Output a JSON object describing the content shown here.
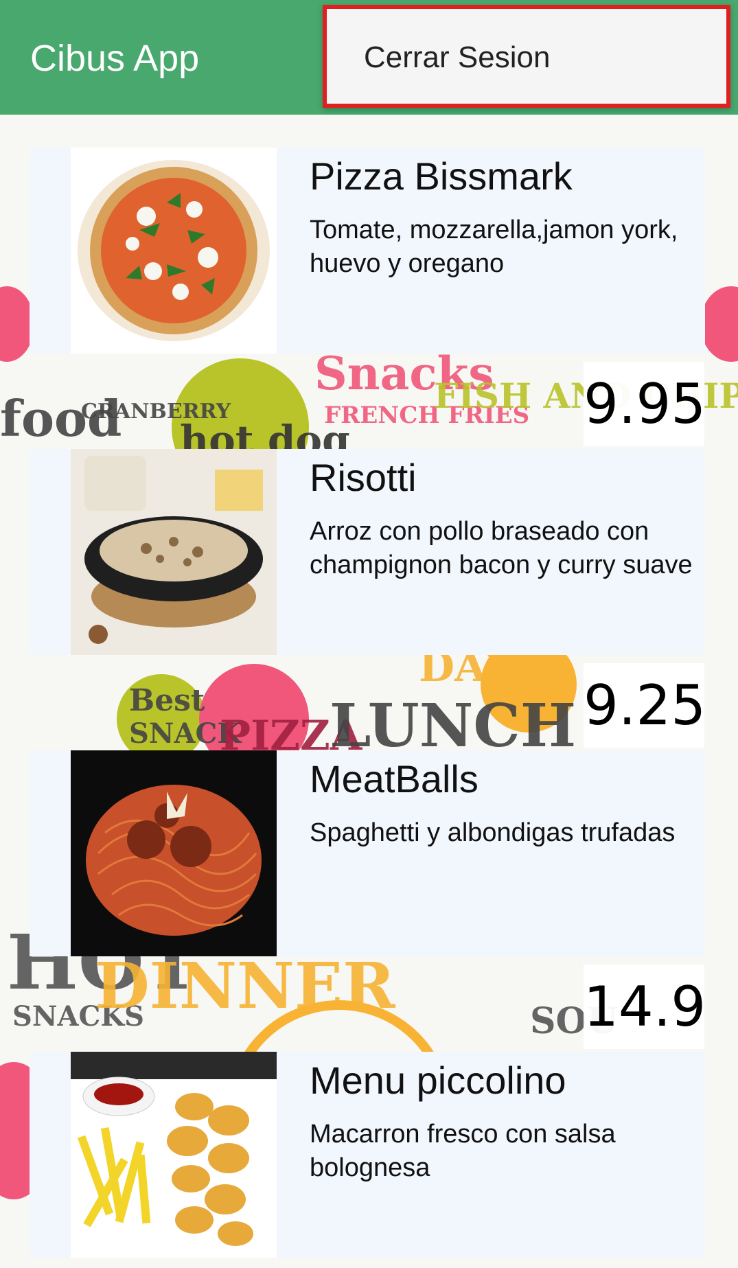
{
  "appbar": {
    "title": "Cibus App",
    "background_color": "#48a86e"
  },
  "overflow_menu": {
    "items": [
      {
        "label": "Cerrar Sesion"
      }
    ],
    "highlight_color": "#e02020"
  },
  "background_doodles": [
    "food",
    "CRANBERRY",
    "hot dog",
    "Snacks",
    "FRENCH FRIES",
    "FISH AND CHIP",
    "Best",
    "SNACK",
    "PIZZA",
    "LUNCH",
    "DAY",
    "HOT",
    "SNACKS",
    "DINNER",
    "SOU"
  ],
  "menu": [
    {
      "name": "Pizza Bissmark",
      "description": "Tomate, mozzarella,jamon york, huevo y oregano",
      "price": "9.95",
      "image_icon": "pizza-image"
    },
    {
      "name": "Risotti",
      "description": "Arroz con pollo braseado con champignon bacon y curry suave",
      "price": "9.25",
      "image_icon": "risotto-image"
    },
    {
      "name": "MeatBalls",
      "description": "Spaghetti y albondigas trufadas",
      "price": "14.9",
      "image_icon": "meatballs-image"
    },
    {
      "name": "Menu piccolino",
      "description": "Macarron fresco con salsa bolognesa",
      "price": "",
      "image_icon": "nuggets-fries-image"
    }
  ]
}
